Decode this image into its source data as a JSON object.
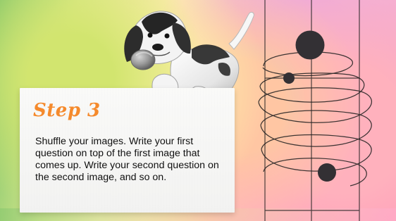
{
  "card": {
    "title": "Step 3",
    "body": "Shuffle your images. Write your first question on top of the first image that comes up. Write your second question on the second image, and so on."
  },
  "colors": {
    "title": "#f58a2c",
    "text": "#111111",
    "card_background": "#f8f8f6",
    "line_art": "#222222"
  },
  "icons": {
    "dog": "beagle-puppy-cutout",
    "diagram": "spiral-grid-graphic"
  }
}
